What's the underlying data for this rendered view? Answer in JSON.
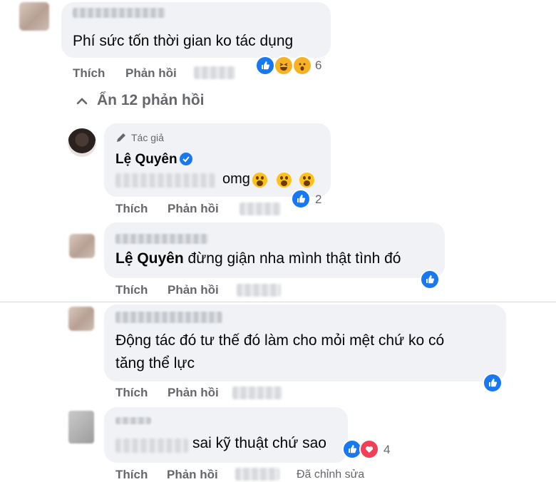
{
  "comments": [
    {
      "text": "Phí sức tốn thời gian ko tác dụng",
      "actions": {
        "like": "Thích",
        "reply": "Phản hồi"
      },
      "reaction_count": "6",
      "reaction_icons": [
        "like-icon",
        "haha-icon",
        "wow-icon"
      ]
    }
  ],
  "replies_toggle": "Ẩn 12 phản hồi",
  "replies": [
    {
      "author_tag": "Tác giả",
      "author_name": "Lệ Quyên",
      "text": "omg",
      "actions": {
        "like": "Thích",
        "reply": "Phản hồi"
      },
      "reaction_count": "2",
      "reaction_icons": [
        "like-icon"
      ]
    },
    {
      "mention": "Lệ Quyên",
      "text": " đừng giận nha mình thật tình đó",
      "actions": {
        "like": "Thích",
        "reply": "Phản hồi"
      },
      "reaction_icons": [
        "like-icon"
      ]
    },
    {
      "text_line1": "Động tác đó tư thế đó làm cho mỏi mệt chứ ko có",
      "text_line2": "tăng thể lực",
      "actions": {
        "like": "Thích",
        "reply": "Phản hồi"
      },
      "reaction_icons": [
        "like-icon"
      ]
    },
    {
      "text": "sai kỹ thuật chứ sao",
      "actions": {
        "like": "Thích",
        "reply": "Phản hồi"
      },
      "edited": "Đã chỉnh sửa",
      "reaction_count": "4",
      "reaction_icons": [
        "like-icon",
        "care-icon"
      ]
    }
  ],
  "colors": {
    "bubble": "#f0f2f5",
    "secondary_text": "#65676b",
    "like_blue": "#1877f2",
    "text": "#050505"
  }
}
